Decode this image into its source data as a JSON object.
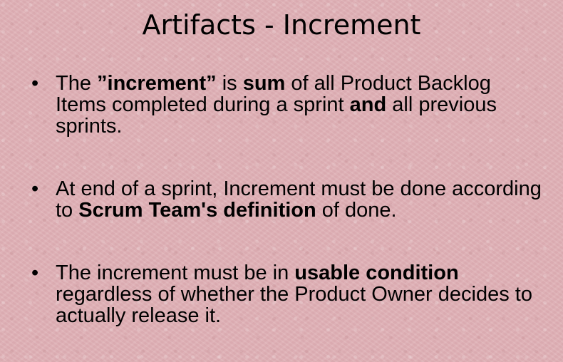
{
  "slide": {
    "title": "Artifacts - Increment",
    "bullet_symbol": "•",
    "bullets": [
      {
        "segments": [
          {
            "text": "The ",
            "bold": false
          },
          {
            "text": "”increment”",
            "bold": true
          },
          {
            "text": " is ",
            "bold": false
          },
          {
            "text": "sum",
            "bold": true
          },
          {
            "text": " of all Product Backlog Items completed during a sprint ",
            "bold": false
          },
          {
            "text": "and",
            "bold": true
          },
          {
            "text": " all previous sprints.",
            "bold": false
          }
        ]
      },
      {
        "segments": [
          {
            "text": "At end of a sprint, Increment must be done according to ",
            "bold": false
          },
          {
            "text": "Scrum Team's definition",
            "bold": true
          },
          {
            "text": " of done.",
            "bold": false
          }
        ]
      },
      {
        "segments": [
          {
            "text": "The increment must be in ",
            "bold": false
          },
          {
            "text": "usable condition",
            "bold": true
          },
          {
            "text": " regardless of whether the Product Owner decides to actually release it.",
            "bold": false
          }
        ]
      }
    ]
  }
}
